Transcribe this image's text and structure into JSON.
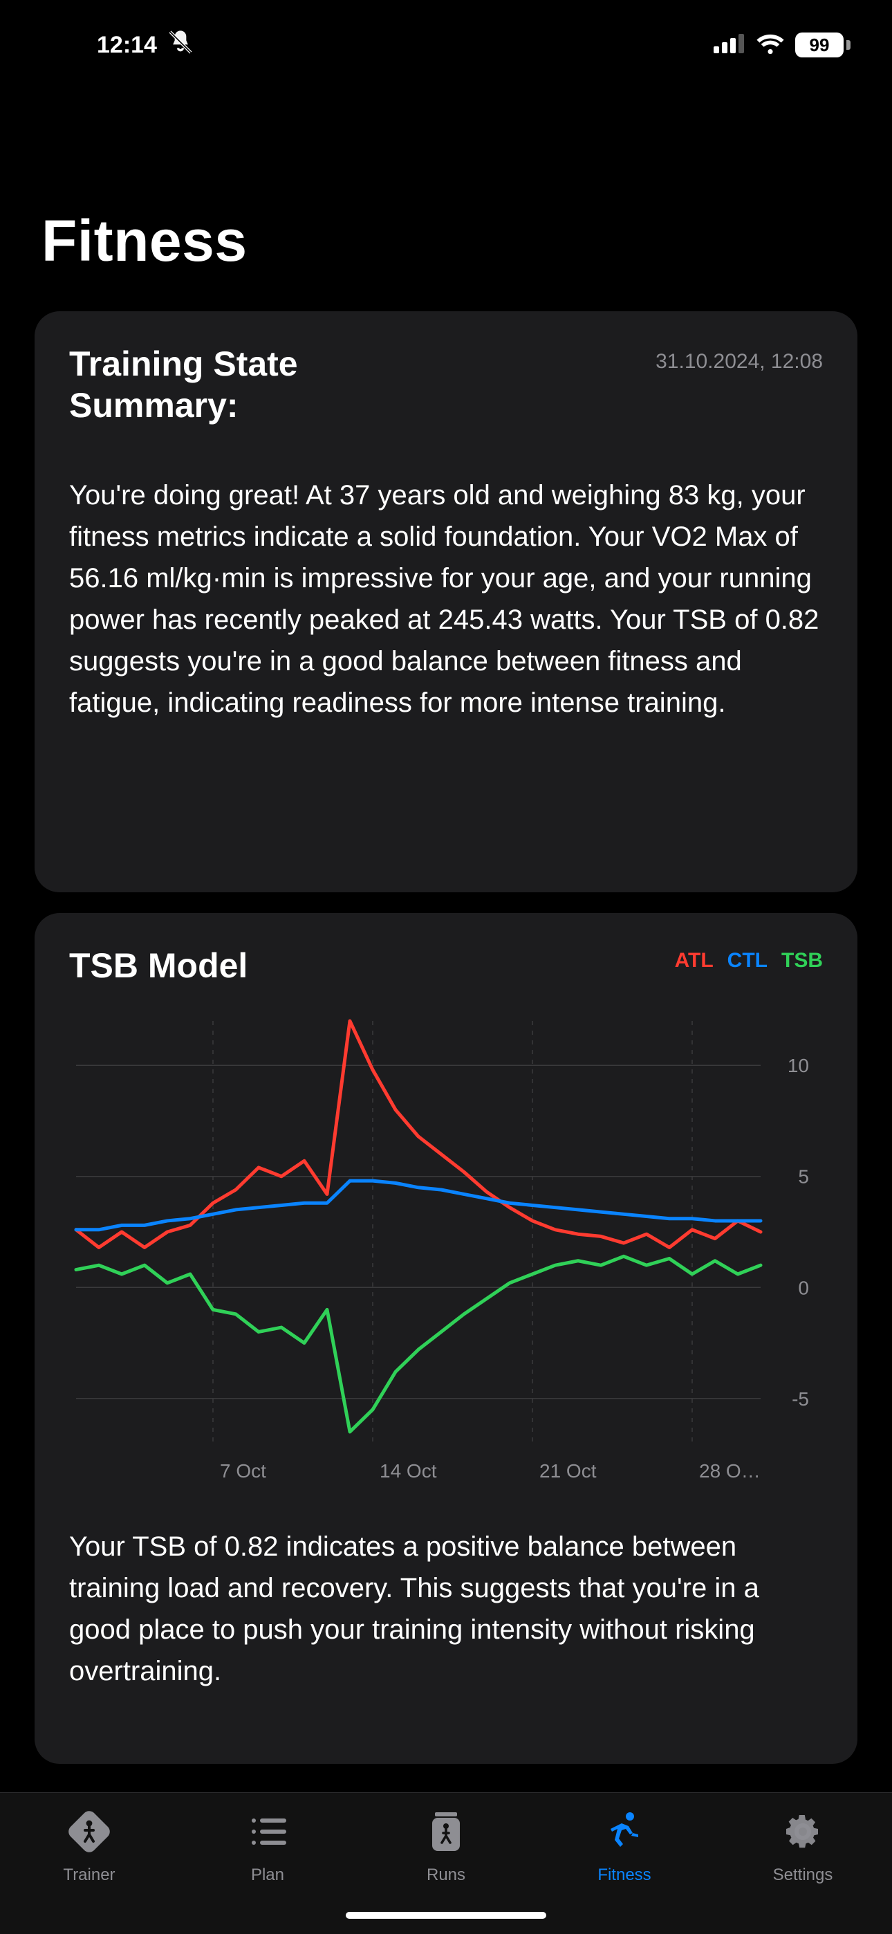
{
  "status_bar": {
    "time": "12:14",
    "battery": "99"
  },
  "page_title": "Fitness",
  "summary_card": {
    "title": "Training State Summary:",
    "timestamp": "31.10.2024, 12:08",
    "body": "You're doing great! At 37 years old and weighing 83 kg, your fitness metrics indicate a solid foundation. Your VO2 Max of 56.16 ml/kg·min is impressive for your age, and your running power has recently peaked at 245.43 watts. Your TSB of 0.82 suggests you're in a good balance between fitness and fatigue, indicating readiness for more intense training."
  },
  "tsb_card": {
    "title": "TSB Model",
    "legend": {
      "atl": "ATL",
      "ctl": "CTL",
      "tsb": "TSB"
    },
    "body": "Your TSB of 0.82 indicates a positive balance between training load and recovery. This suggests that you're in a good place to push your training intensity without risking overtraining."
  },
  "chart_data": {
    "type": "line",
    "xlabel": "",
    "ylabel": "",
    "ylim": [
      -7,
      12
    ],
    "y_ticks": [
      -5,
      0,
      5,
      10
    ],
    "x_ticks": [
      "7 Oct",
      "14 Oct",
      "21 Oct",
      "28 O…"
    ],
    "x_tick_positions": [
      6,
      13,
      20,
      27
    ],
    "x_range": [
      0,
      30
    ],
    "series": [
      {
        "name": "ATL",
        "color": "#ff3b30",
        "values": [
          2.6,
          1.8,
          2.5,
          1.8,
          2.5,
          2.8,
          3.8,
          4.4,
          5.4,
          5.0,
          5.7,
          4.2,
          12.0,
          9.8,
          8.0,
          6.8,
          6.0,
          5.2,
          4.3,
          3.6,
          3.0,
          2.6,
          2.4,
          2.3,
          2.0,
          2.4,
          1.8,
          2.6,
          2.2,
          3.0,
          2.5
        ]
      },
      {
        "name": "CTL",
        "color": "#0a84ff",
        "values": [
          2.6,
          2.6,
          2.8,
          2.8,
          3.0,
          3.1,
          3.3,
          3.5,
          3.6,
          3.7,
          3.8,
          3.8,
          4.8,
          4.8,
          4.7,
          4.5,
          4.4,
          4.2,
          4.0,
          3.8,
          3.7,
          3.6,
          3.5,
          3.4,
          3.3,
          3.2,
          3.1,
          3.1,
          3.0,
          3.0,
          3.0
        ]
      },
      {
        "name": "TSB",
        "color": "#30d158",
        "values": [
          0.8,
          1.0,
          0.6,
          1.0,
          0.2,
          0.6,
          -1.0,
          -1.2,
          -2.0,
          -1.8,
          -2.5,
          -1.0,
          -6.5,
          -5.5,
          -3.8,
          -2.8,
          -2.0,
          -1.2,
          -0.5,
          0.2,
          0.6,
          1.0,
          1.2,
          1.0,
          1.4,
          1.0,
          1.3,
          0.6,
          1.2,
          0.6,
          1.0
        ]
      }
    ]
  },
  "tabs": [
    {
      "id": "trainer",
      "label": "Trainer",
      "active": false
    },
    {
      "id": "plan",
      "label": "Plan",
      "active": false
    },
    {
      "id": "runs",
      "label": "Runs",
      "active": false
    },
    {
      "id": "fitness",
      "label": "Fitness",
      "active": true
    },
    {
      "id": "settings",
      "label": "Settings",
      "active": false
    }
  ]
}
